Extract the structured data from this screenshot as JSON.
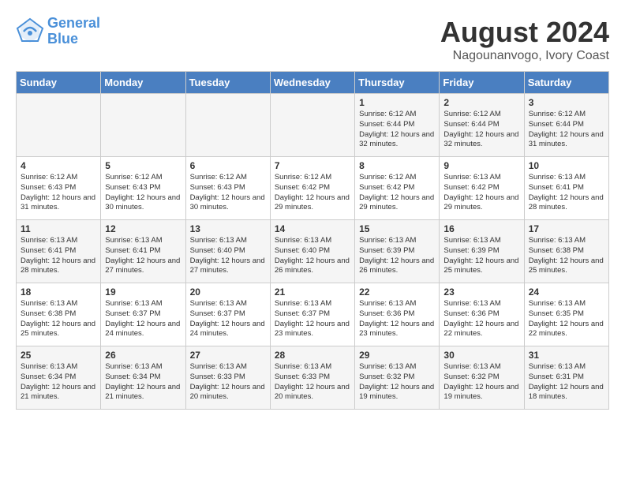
{
  "header": {
    "logo_line1": "General",
    "logo_line2": "Blue",
    "title": "August 2024",
    "subtitle": "Nagounanvogo, Ivory Coast"
  },
  "days_of_week": [
    "Sunday",
    "Monday",
    "Tuesday",
    "Wednesday",
    "Thursday",
    "Friday",
    "Saturday"
  ],
  "weeks": [
    [
      {
        "day": "",
        "content": ""
      },
      {
        "day": "",
        "content": ""
      },
      {
        "day": "",
        "content": ""
      },
      {
        "day": "",
        "content": ""
      },
      {
        "day": "1",
        "content": "Sunrise: 6:12 AM\nSunset: 6:44 PM\nDaylight: 12 hours\nand 32 minutes."
      },
      {
        "day": "2",
        "content": "Sunrise: 6:12 AM\nSunset: 6:44 PM\nDaylight: 12 hours\nand 32 minutes."
      },
      {
        "day": "3",
        "content": "Sunrise: 6:12 AM\nSunset: 6:44 PM\nDaylight: 12 hours\nand 31 minutes."
      }
    ],
    [
      {
        "day": "4",
        "content": "Sunrise: 6:12 AM\nSunset: 6:43 PM\nDaylight: 12 hours\nand 31 minutes."
      },
      {
        "day": "5",
        "content": "Sunrise: 6:12 AM\nSunset: 6:43 PM\nDaylight: 12 hours\nand 30 minutes."
      },
      {
        "day": "6",
        "content": "Sunrise: 6:12 AM\nSunset: 6:43 PM\nDaylight: 12 hours\nand 30 minutes."
      },
      {
        "day": "7",
        "content": "Sunrise: 6:12 AM\nSunset: 6:42 PM\nDaylight: 12 hours\nand 29 minutes."
      },
      {
        "day": "8",
        "content": "Sunrise: 6:12 AM\nSunset: 6:42 PM\nDaylight: 12 hours\nand 29 minutes."
      },
      {
        "day": "9",
        "content": "Sunrise: 6:13 AM\nSunset: 6:42 PM\nDaylight: 12 hours\nand 29 minutes."
      },
      {
        "day": "10",
        "content": "Sunrise: 6:13 AM\nSunset: 6:41 PM\nDaylight: 12 hours\nand 28 minutes."
      }
    ],
    [
      {
        "day": "11",
        "content": "Sunrise: 6:13 AM\nSunset: 6:41 PM\nDaylight: 12 hours\nand 28 minutes."
      },
      {
        "day": "12",
        "content": "Sunrise: 6:13 AM\nSunset: 6:41 PM\nDaylight: 12 hours\nand 27 minutes."
      },
      {
        "day": "13",
        "content": "Sunrise: 6:13 AM\nSunset: 6:40 PM\nDaylight: 12 hours\nand 27 minutes."
      },
      {
        "day": "14",
        "content": "Sunrise: 6:13 AM\nSunset: 6:40 PM\nDaylight: 12 hours\nand 26 minutes."
      },
      {
        "day": "15",
        "content": "Sunrise: 6:13 AM\nSunset: 6:39 PM\nDaylight: 12 hours\nand 26 minutes."
      },
      {
        "day": "16",
        "content": "Sunrise: 6:13 AM\nSunset: 6:39 PM\nDaylight: 12 hours\nand 25 minutes."
      },
      {
        "day": "17",
        "content": "Sunrise: 6:13 AM\nSunset: 6:38 PM\nDaylight: 12 hours\nand 25 minutes."
      }
    ],
    [
      {
        "day": "18",
        "content": "Sunrise: 6:13 AM\nSunset: 6:38 PM\nDaylight: 12 hours\nand 25 minutes."
      },
      {
        "day": "19",
        "content": "Sunrise: 6:13 AM\nSunset: 6:37 PM\nDaylight: 12 hours\nand 24 minutes."
      },
      {
        "day": "20",
        "content": "Sunrise: 6:13 AM\nSunset: 6:37 PM\nDaylight: 12 hours\nand 24 minutes."
      },
      {
        "day": "21",
        "content": "Sunrise: 6:13 AM\nSunset: 6:37 PM\nDaylight: 12 hours\nand 23 minutes."
      },
      {
        "day": "22",
        "content": "Sunrise: 6:13 AM\nSunset: 6:36 PM\nDaylight: 12 hours\nand 23 minutes."
      },
      {
        "day": "23",
        "content": "Sunrise: 6:13 AM\nSunset: 6:36 PM\nDaylight: 12 hours\nand 22 minutes."
      },
      {
        "day": "24",
        "content": "Sunrise: 6:13 AM\nSunset: 6:35 PM\nDaylight: 12 hours\nand 22 minutes."
      }
    ],
    [
      {
        "day": "25",
        "content": "Sunrise: 6:13 AM\nSunset: 6:34 PM\nDaylight: 12 hours\nand 21 minutes."
      },
      {
        "day": "26",
        "content": "Sunrise: 6:13 AM\nSunset: 6:34 PM\nDaylight: 12 hours\nand 21 minutes."
      },
      {
        "day": "27",
        "content": "Sunrise: 6:13 AM\nSunset: 6:33 PM\nDaylight: 12 hours\nand 20 minutes."
      },
      {
        "day": "28",
        "content": "Sunrise: 6:13 AM\nSunset: 6:33 PM\nDaylight: 12 hours\nand 20 minutes."
      },
      {
        "day": "29",
        "content": "Sunrise: 6:13 AM\nSunset: 6:32 PM\nDaylight: 12 hours\nand 19 minutes."
      },
      {
        "day": "30",
        "content": "Sunrise: 6:13 AM\nSunset: 6:32 PM\nDaylight: 12 hours\nand 19 minutes."
      },
      {
        "day": "31",
        "content": "Sunrise: 6:13 AM\nSunset: 6:31 PM\nDaylight: 12 hours\nand 18 minutes."
      }
    ]
  ]
}
